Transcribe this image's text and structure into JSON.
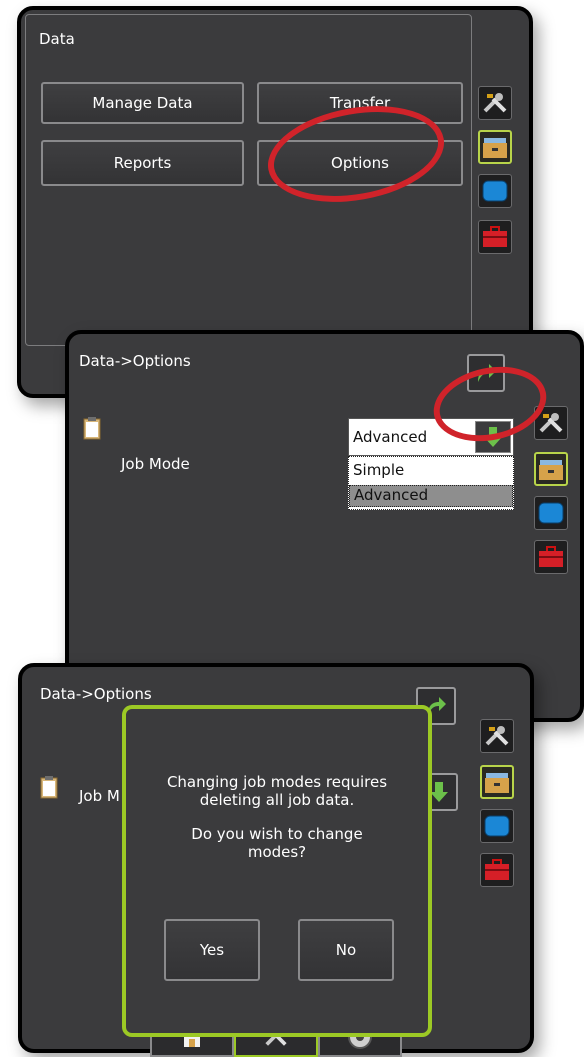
{
  "panel1": {
    "title": "Data",
    "buttons": {
      "manage_data": "Manage Data",
      "transfer": "Transfer",
      "reports": "Reports",
      "options": "Options"
    }
  },
  "panel2": {
    "title": "Data->Options",
    "job_mode_label": "Job Mode",
    "job_mode_value": "Advanced",
    "options": [
      "Simple",
      "Advanced"
    ]
  },
  "panel3": {
    "title": "Data->Options",
    "job_mode_label_partial": "Job M",
    "dialog": {
      "line1": "Changing job modes requires",
      "line2": "deleting all job data.",
      "line3": "Do you wish to change",
      "line4": "modes?",
      "yes": "Yes",
      "no": "No"
    }
  },
  "sidebar_icons": [
    "tools-icon",
    "data-box-icon",
    "display-icon",
    "toolbox-icon"
  ],
  "bottom_tabs": [
    "home-icon",
    "tools-icon",
    "gauge-icon"
  ],
  "colors": {
    "highlight_red": "#d0232a",
    "accent_green": "#9cc925",
    "panel_bg": "#3b3b3d"
  }
}
